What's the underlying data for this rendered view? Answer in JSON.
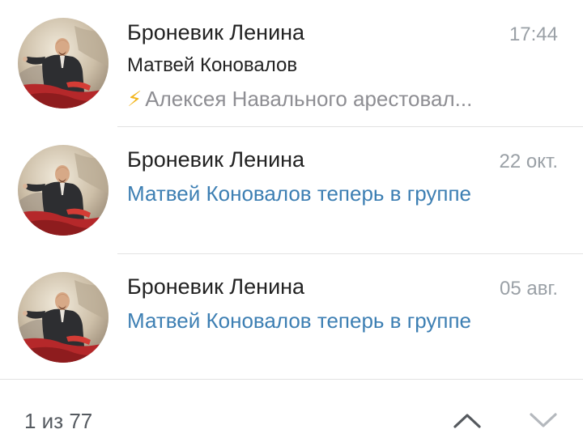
{
  "chats": [
    {
      "title": "Броневик Ленина",
      "time": "17:44",
      "sender": "Матвей Коновалов",
      "preview_icon": "⚡",
      "preview": "Алексея Навального арестовал..."
    },
    {
      "title": "Броневик Ленина",
      "time": "22 окт.",
      "system_message": "Матвей Коновалов теперь в группе"
    },
    {
      "title": "Броневик Ленина",
      "time": "05 авг.",
      "system_message": "Матвей Коновалов теперь в группе"
    }
  ],
  "footer": {
    "counter": "1 из 77",
    "up_icon": "chevron-up-icon",
    "down_icon": "chevron-down-icon"
  },
  "colors": {
    "system_message": "#3d7fb3",
    "time": "#9aa0a6",
    "bolt": "#f2b51c"
  }
}
